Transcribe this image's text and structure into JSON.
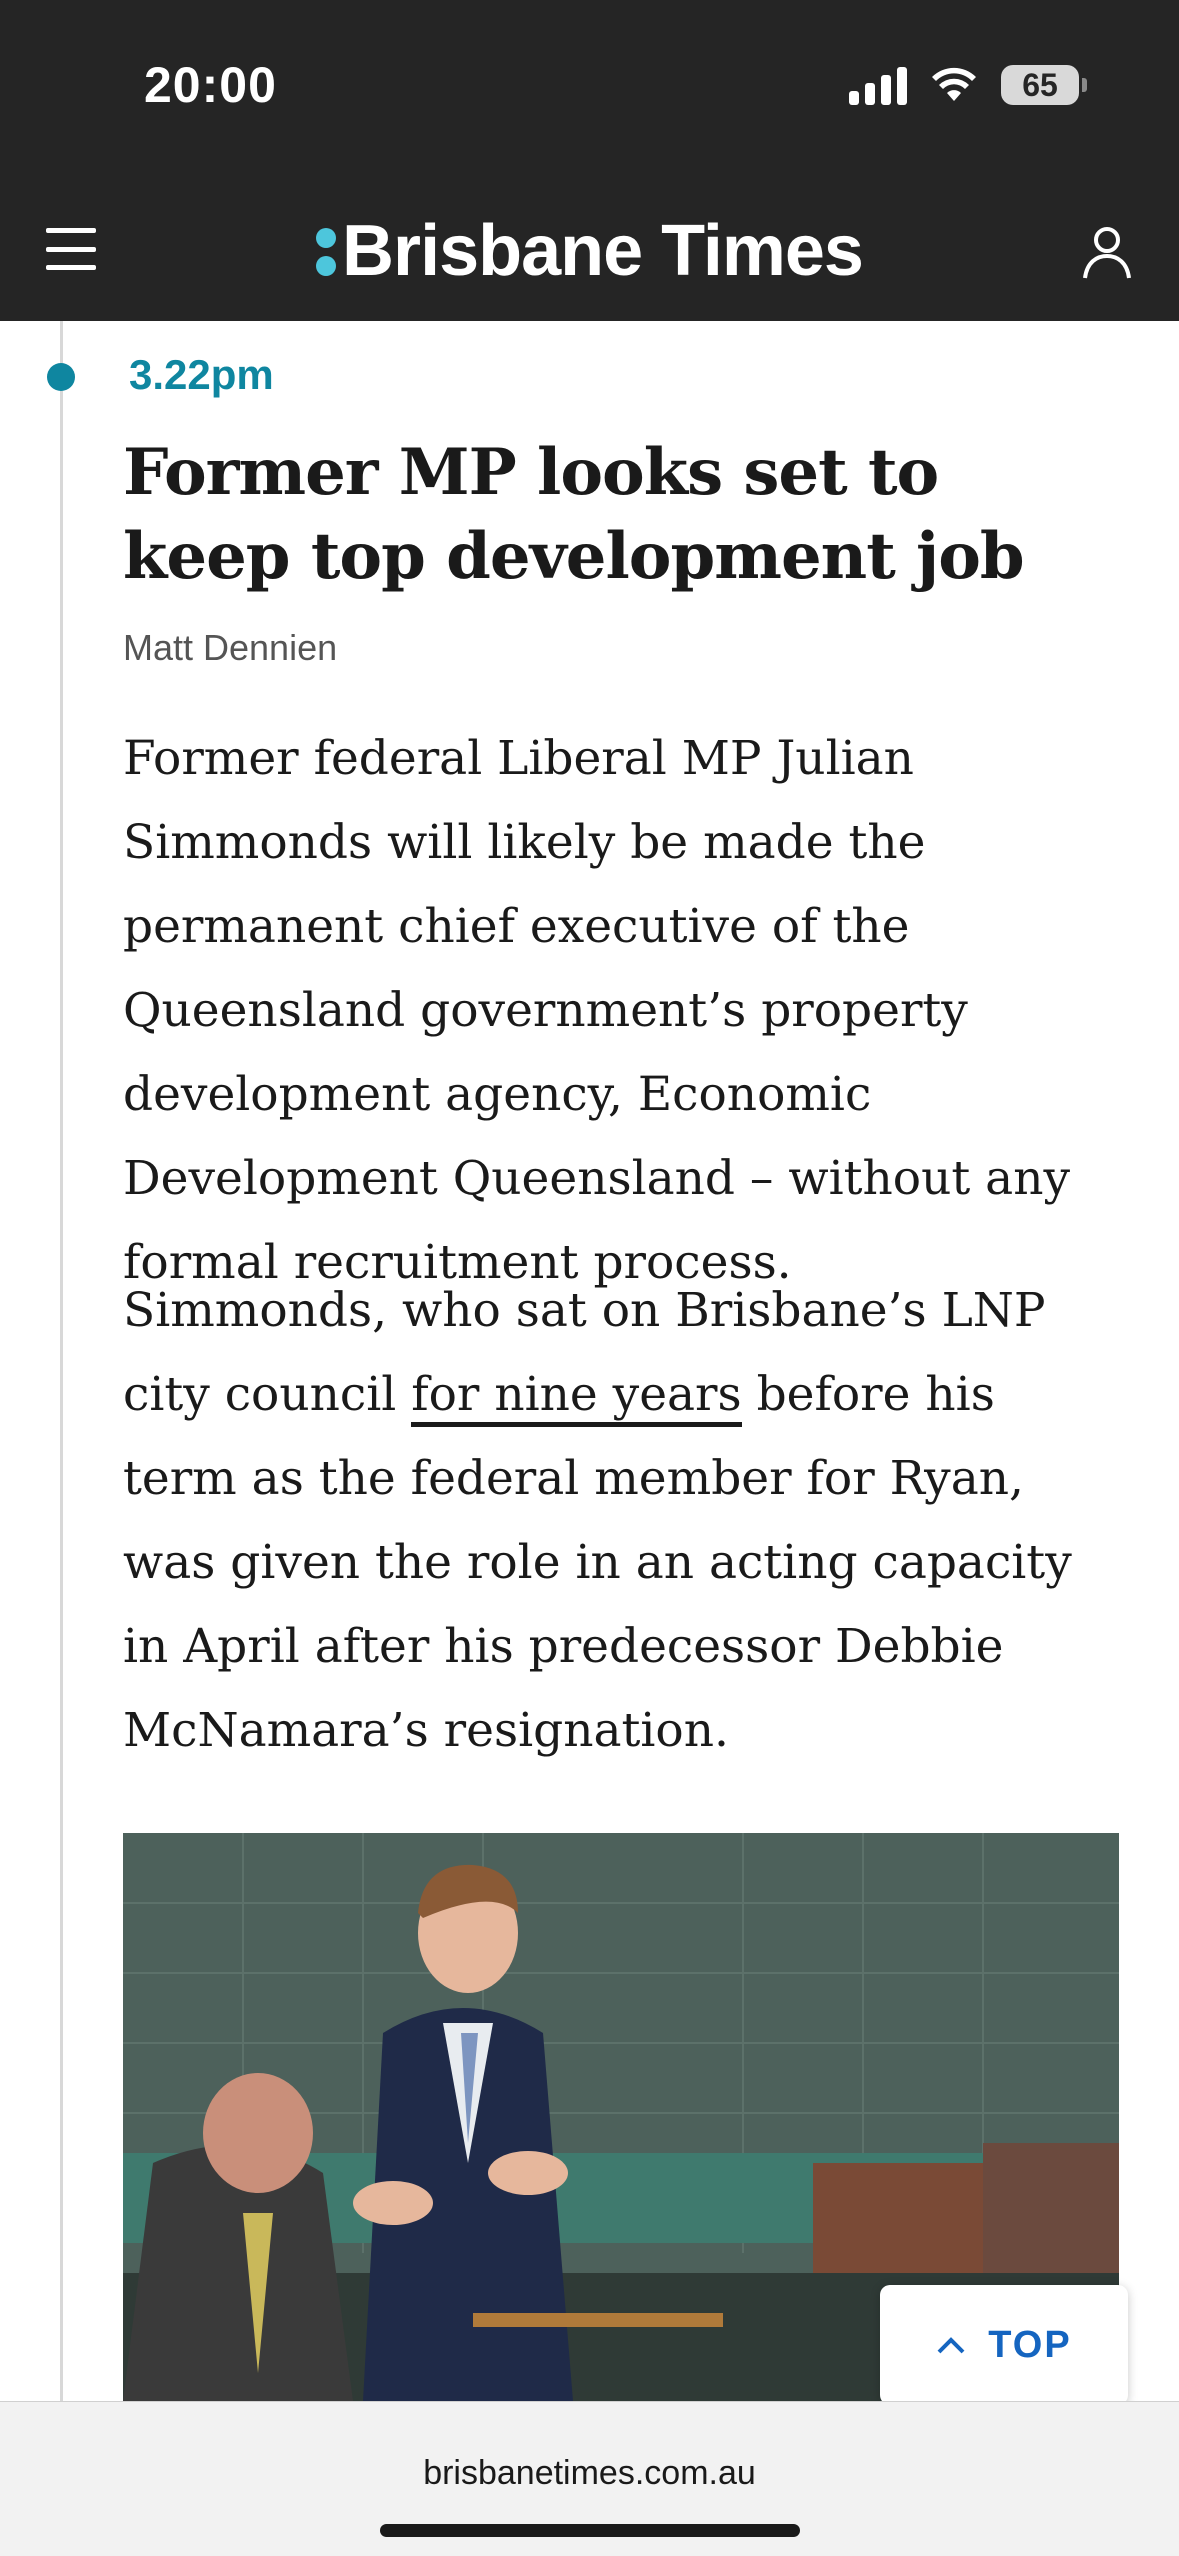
{
  "status_bar": {
    "time": "20:00",
    "battery": "65"
  },
  "header": {
    "site_name": "Brisbane Times",
    "menu_icon": "hamburger-menu-icon",
    "account_icon": "user-account-icon",
    "accent_color": "#4dc6dc"
  },
  "post": {
    "time": "3.22pm",
    "title": "Former MP looks set to keep top development job",
    "author": "Matt Dennien",
    "paragraph1": "Former federal Liberal MP Julian Simmonds will likely be made the permanent chief executive of the Queensland government’s property development agency, Economic Development Queensland – without any formal recruitment process.",
    "paragraph2_before": "Simmonds, who sat on Brisbane’s LNP city council ",
    "paragraph2_link": "for nine years",
    "paragraph2_after": " before his term as the federal member for Ryan, was given the role in an acting capacity in April after his predecessor Debbie McNamara’s resignation.",
    "accent_color": "#0f86a0"
  },
  "top_button": {
    "label": "TOP",
    "icon": "chevron-up-icon"
  },
  "browser": {
    "url": "brisbanetimes.com.au"
  }
}
